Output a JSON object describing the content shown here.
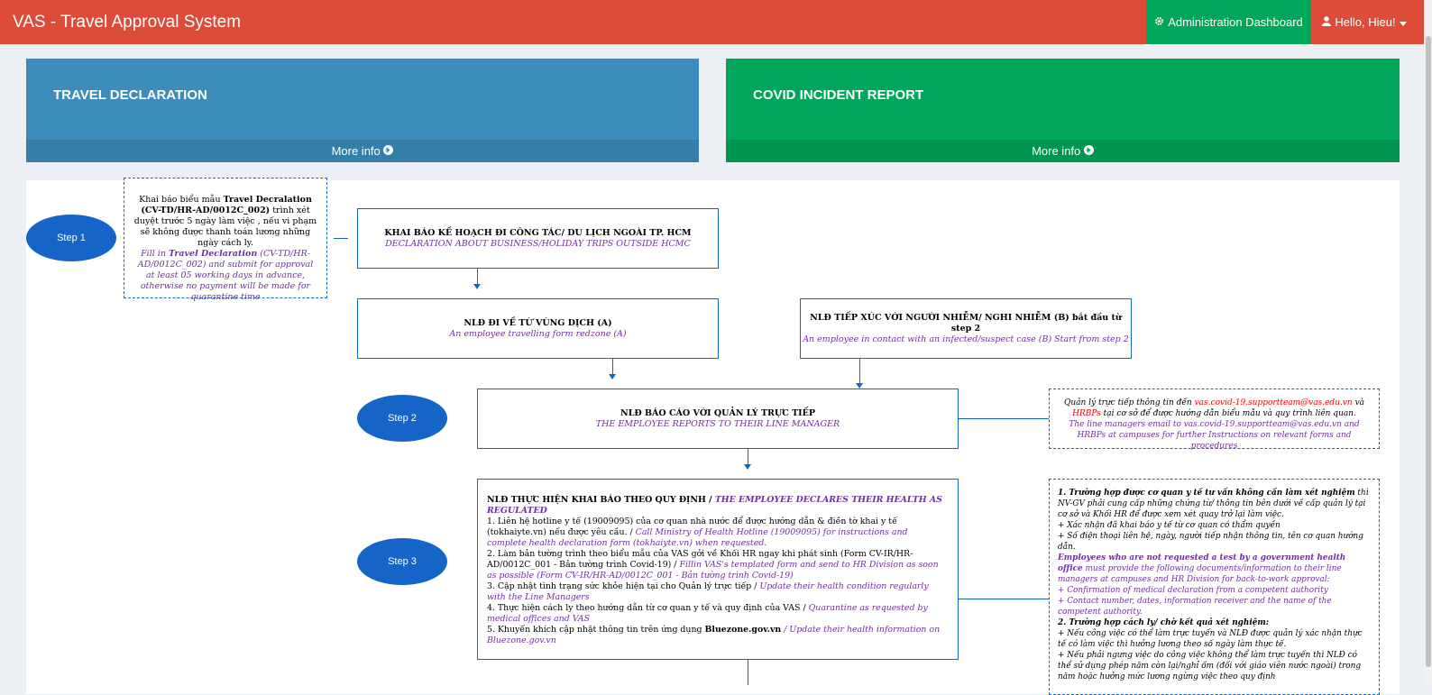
{
  "app": {
    "title": "VAS - Travel Approval System",
    "admin_label": "Administration Dashboard",
    "user_label": "Hello, Hieu!"
  },
  "boxes": [
    {
      "title": "TRAVEL DECLARATION",
      "more": "More info",
      "color": "#3c8dbc"
    },
    {
      "title": "COVID INCIDENT REPORT",
      "more": "More info",
      "color": "#00a65a"
    }
  ],
  "flow": {
    "steps": [
      "Step 1",
      "Step 2",
      "Step 3"
    ],
    "note1": {
      "vi_pre": "Khai báo biểu mẫu ",
      "vi_bold": "Travel Decralation (CV-TD/HR-AD/0012C_002)",
      "vi_post": " trình xét duyệt trước 5 ngày làm việc , nếu vi phạm sẽ không được thanh toán lương những ngày cách ly.",
      "en_pre": "Fill in ",
      "en_bold": "Travel Declaration",
      "en_post": " (CV-TD/HR-AD/0012C_002) and submit for approval at least 05 working days in advance, otherwise no payment will be made for quarantine time"
    },
    "plan": {
      "vi": "KHAI BÁO KẾ HOẠCH ĐI CÔNG TÁC/ DU LỊCH NGOÀI TP. HCM",
      "en": "DECLARATION ABOUT BUSINESS/HOLIDAY TRIPS OUTSIDE HCMC"
    },
    "case_a": {
      "vi": "NLĐ ĐI VỀ TỪ VÙNG DỊCH (A)",
      "en": "An employee travelling form redzone (A)"
    },
    "case_b": {
      "vi": "NLĐ TIẾP XÚC VỚI NGƯỜI NHIỄM/ NGHI NHIỄM (B) bắt đầu từ step 2",
      "en": "An employee in contact with an infected/suspect case (B) Start from  step 2"
    },
    "report": {
      "vi": "NLĐ BÁO CÁO VỚI QUẢN LÝ TRỰC TIẾP",
      "en": "THE EMPLOYEE REPORTS TO THEIR LINE MANAGER"
    },
    "note2": {
      "vi_pre": "Quản lý trực tiếp thông tin đến ",
      "vi_red1": "vas.covid-19.supportteam@vas.edu.vn",
      "vi_mid": " và ",
      "vi_red2": "HRBPs",
      "vi_post": " tại cơ sở để được hướng dẫn biểu mẫu và quy trình liên quan.",
      "en": "The line managers email to vas.covid-19.supportteam@vas.edu.vn and HRBPs at campuses for further Instructions on relevant forms and procedures"
    },
    "declare": {
      "heading_vi": "NLĐ THỰC HIỆN KHAI BÁO THEO QUY ĐỊNH / ",
      "heading_en": "THE EMPLOYEE DECLARES THEIR HEALTH AS REGULATED",
      "items": [
        {
          "vi": "1. Liên hệ hotline y tế (19009095) của cơ quan nhà nước để được hướng dẫn & điền tờ khai y tế (tokhaiyte.vn) nếu được yêu cầu. / ",
          "en": "Call Ministry of Health Hotline (19009095) for instructions and complete health declaration form (tokhaiyte.vn) when requested."
        },
        {
          "vi": "2. Làm bản tường trình theo biểu mẫu của VAS gởi về Khối HR ngay khi phát sinh (Form CV-IR/HR-AD/0012C_001 - Bản tường trình Covid-19) / ",
          "en": "Fillin VAS's templated form and send to HR Division as soon as possible (Form CV-IR/HR-AD/0012C_001 - Bản tường trình Covid-19)"
        },
        {
          "vi": "3. Cập nhật tình trạng sức khỏe hiện tại cho Quản lý trực tiếp / ",
          "en": "Update their health condition regularly with the Line Managers"
        },
        {
          "vi": "4. Thực hiện cách ly theo hướng dẫn từ cơ quan y tế và quy định của VAS / ",
          "en": "Quarantine as requested by medical offices and VAS"
        },
        {
          "vi": "5. Khuyến khích cập nhật thông tin trên ứng dụng ",
          "bold": "Bluezone.gov.vn",
          "en": " / Update their health information on Bluezone.gov.vn"
        }
      ]
    },
    "note3": {
      "l1_bold": "1. Trường hợp được cơ quan y tế tư vấn không cần làm xét nghiệm",
      "l1_rest": " thì NV-GV phải cung cấp những chứng từ/ thông tin bên dưới về cấp quản lý tại cơ sở và Khối HR để được xem xét quay trở lại làm việc.",
      "l2": "+ Xác nhận đã khai báo y tế từ cơ quan có thẩm quyền",
      "l3": "+ Số điện thoại liên hệ, ngày, người tiếp nhận thông tin, tên cơ quan hướng dẫn.",
      "l4_bold": "Employees who are not requested a test by a government health office",
      "l4_rest": " must provide the following documents/information to their line managers at campuses and HR Division for back-to-work approval:",
      "l5": "+ Confirmation of medical declaration from a competent authority",
      "l6": "+ Contact number, dates, information receiver and the name of the competent authority.",
      "l7": "2. Trường hợp cách ly/ chờ kết quả xét nghiệm:",
      "l8": "+ Nếu công việc có thể làm trực tuyến và NLĐ được quản lý xác nhận thực tế có làm việc thì hưởng lương theo số ngày làm thực tế.",
      "l9": "+ Nếu phải ngưng việc do công việc không thể làm trực tuyến thì NLĐ có thể sử dụng phép năm còn lại/nghỉ ốm  (đối với giáo viên nước ngoài) trong năm hoặc hưởng mức lương ngừng việc theo quy định"
    }
  }
}
